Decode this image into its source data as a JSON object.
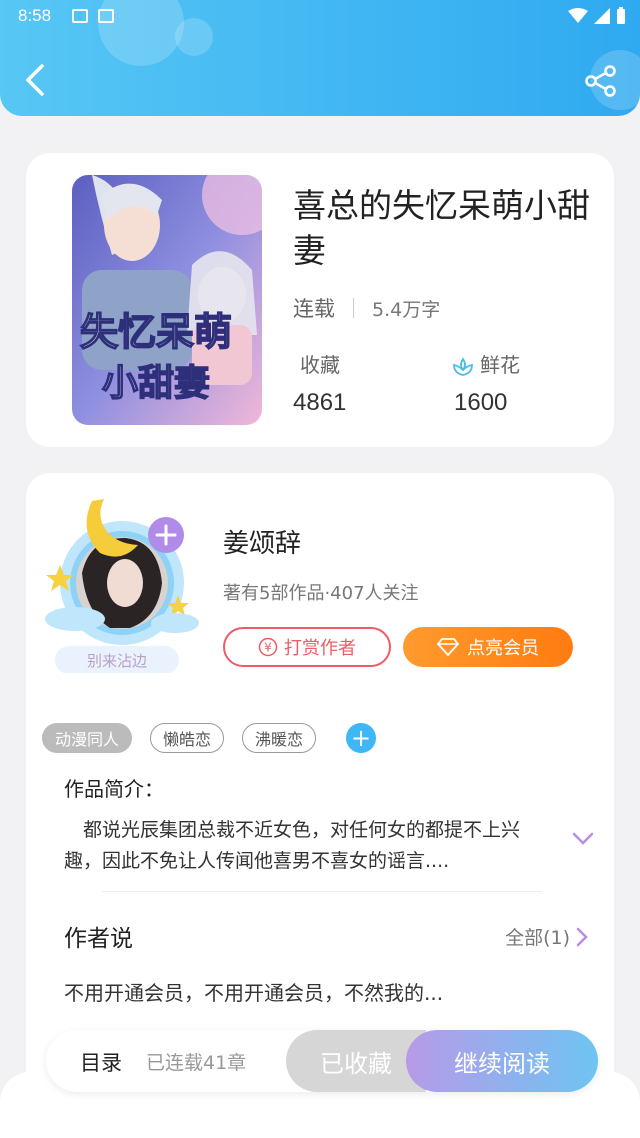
{
  "status": {
    "time": "8:58"
  },
  "header": {
    "back_icon": "back-arrow-icon",
    "share_icon": "share-icon",
    "color": "#3fb5f2"
  },
  "book": {
    "title": "喜总的失忆呆萌小甜妻",
    "status": "连载",
    "word_count": "5.4万字",
    "collect_label": "收藏",
    "collect_value": "4861",
    "flower_label": "鲜花",
    "flower_value": "1600"
  },
  "author": {
    "name": "姜颂辞",
    "info": "著有5部作品·407人关注",
    "badge": "别来沾边",
    "reward_label": "打赏作者",
    "vip_label": "点亮会员"
  },
  "tags": [
    "动漫同人",
    "懒皓恋",
    "沸暖恋"
  ],
  "intro": {
    "label": "作品简介：",
    "text": "都说光辰集团总裁不近女色，对任何女的都提不上兴趣，因此不免让人传闻他喜男不喜女的谣言...."
  },
  "author_say": {
    "label": "作者说",
    "all_label": "全部(1)",
    "text": "不用开通会员，不用开通会员，不然我的..."
  },
  "bottom": {
    "toc_label": "目录",
    "chapters": "已连载41章",
    "collected_label": "已收藏",
    "read_label": "继续阅读"
  }
}
